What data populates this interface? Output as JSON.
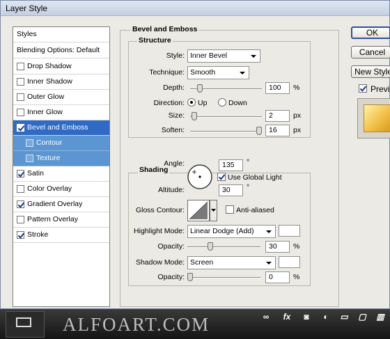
{
  "window": {
    "title": "Layer Style"
  },
  "styles_list": {
    "header": "Styles",
    "blending_options": "Blending Options: Default",
    "items": [
      {
        "label": "Drop Shadow",
        "checked": false,
        "state": "normal"
      },
      {
        "label": "Inner Shadow",
        "checked": false,
        "state": "normal"
      },
      {
        "label": "Outer Glow",
        "checked": false,
        "state": "normal"
      },
      {
        "label": "Inner Glow",
        "checked": false,
        "state": "normal"
      },
      {
        "label": "Bevel and Emboss",
        "checked": true,
        "state": "selected"
      },
      {
        "label": "Contour",
        "checked": false,
        "state": "sub"
      },
      {
        "label": "Texture",
        "checked": false,
        "state": "sub"
      },
      {
        "label": "Satin",
        "checked": true,
        "state": "normal"
      },
      {
        "label": "Color Overlay",
        "checked": false,
        "state": "normal"
      },
      {
        "label": "Gradient Overlay",
        "checked": true,
        "state": "normal"
      },
      {
        "label": "Pattern Overlay",
        "checked": false,
        "state": "normal"
      },
      {
        "label": "Stroke",
        "checked": true,
        "state": "normal"
      }
    ]
  },
  "bevel_emboss": {
    "title": "Bevel and Emboss",
    "structure": {
      "title": "Structure",
      "style_label": "Style:",
      "style_value": "Inner Bevel",
      "technique_label": "Technique:",
      "technique_value": "Smooth",
      "depth_label": "Depth:",
      "depth_value": "100",
      "depth_unit": "%",
      "depth_slider_fraction": 0.1,
      "direction_label": "Direction:",
      "direction_up": "Up",
      "direction_down": "Down",
      "direction_selected": "Up",
      "size_label": "Size:",
      "size_value": "2",
      "size_unit": "px",
      "size_slider_fraction": 0.02,
      "soften_label": "Soften:",
      "soften_value": "16",
      "soften_unit": "px",
      "soften_slider_fraction": 1.0
    },
    "shading": {
      "title": "Shading",
      "angle_label": "Angle:",
      "angle_value": "135",
      "angle_unit": "°",
      "use_global_light": "Use Global Light",
      "use_global_light_checked": true,
      "altitude_label": "Altitude:",
      "altitude_value": "30",
      "altitude_unit": "°",
      "gloss_contour_label": "Gloss Contour:",
      "anti_aliased": "Anti-aliased",
      "anti_aliased_checked": false,
      "highlight_mode_label": "Highlight Mode:",
      "highlight_mode_value": "Linear Dodge (Add)",
      "highlight_color": "#ffffff",
      "highlight_opacity_label": "Opacity:",
      "highlight_opacity_value": "30",
      "highlight_opacity_unit": "%",
      "highlight_opacity_fraction": 0.3,
      "shadow_mode_label": "Shadow Mode:",
      "shadow_mode_value": "Screen",
      "shadow_color": "#ffffff",
      "shadow_opacity_label": "Opacity:",
      "shadow_opacity_value": "0",
      "shadow_opacity_unit": "%",
      "shadow_opacity_fraction": 0.0
    }
  },
  "buttons": {
    "ok": "OK",
    "cancel": "Cancel",
    "new_style": "New Style",
    "preview": "Preview",
    "preview_checked": true
  },
  "watermark": "ALFOART.COM",
  "colors": {
    "dialog_bg": "#eceae4",
    "selection_blue": "#316ac5",
    "sub_item_blue": "#5b96d3",
    "preview_gold": "#f2c14a"
  }
}
